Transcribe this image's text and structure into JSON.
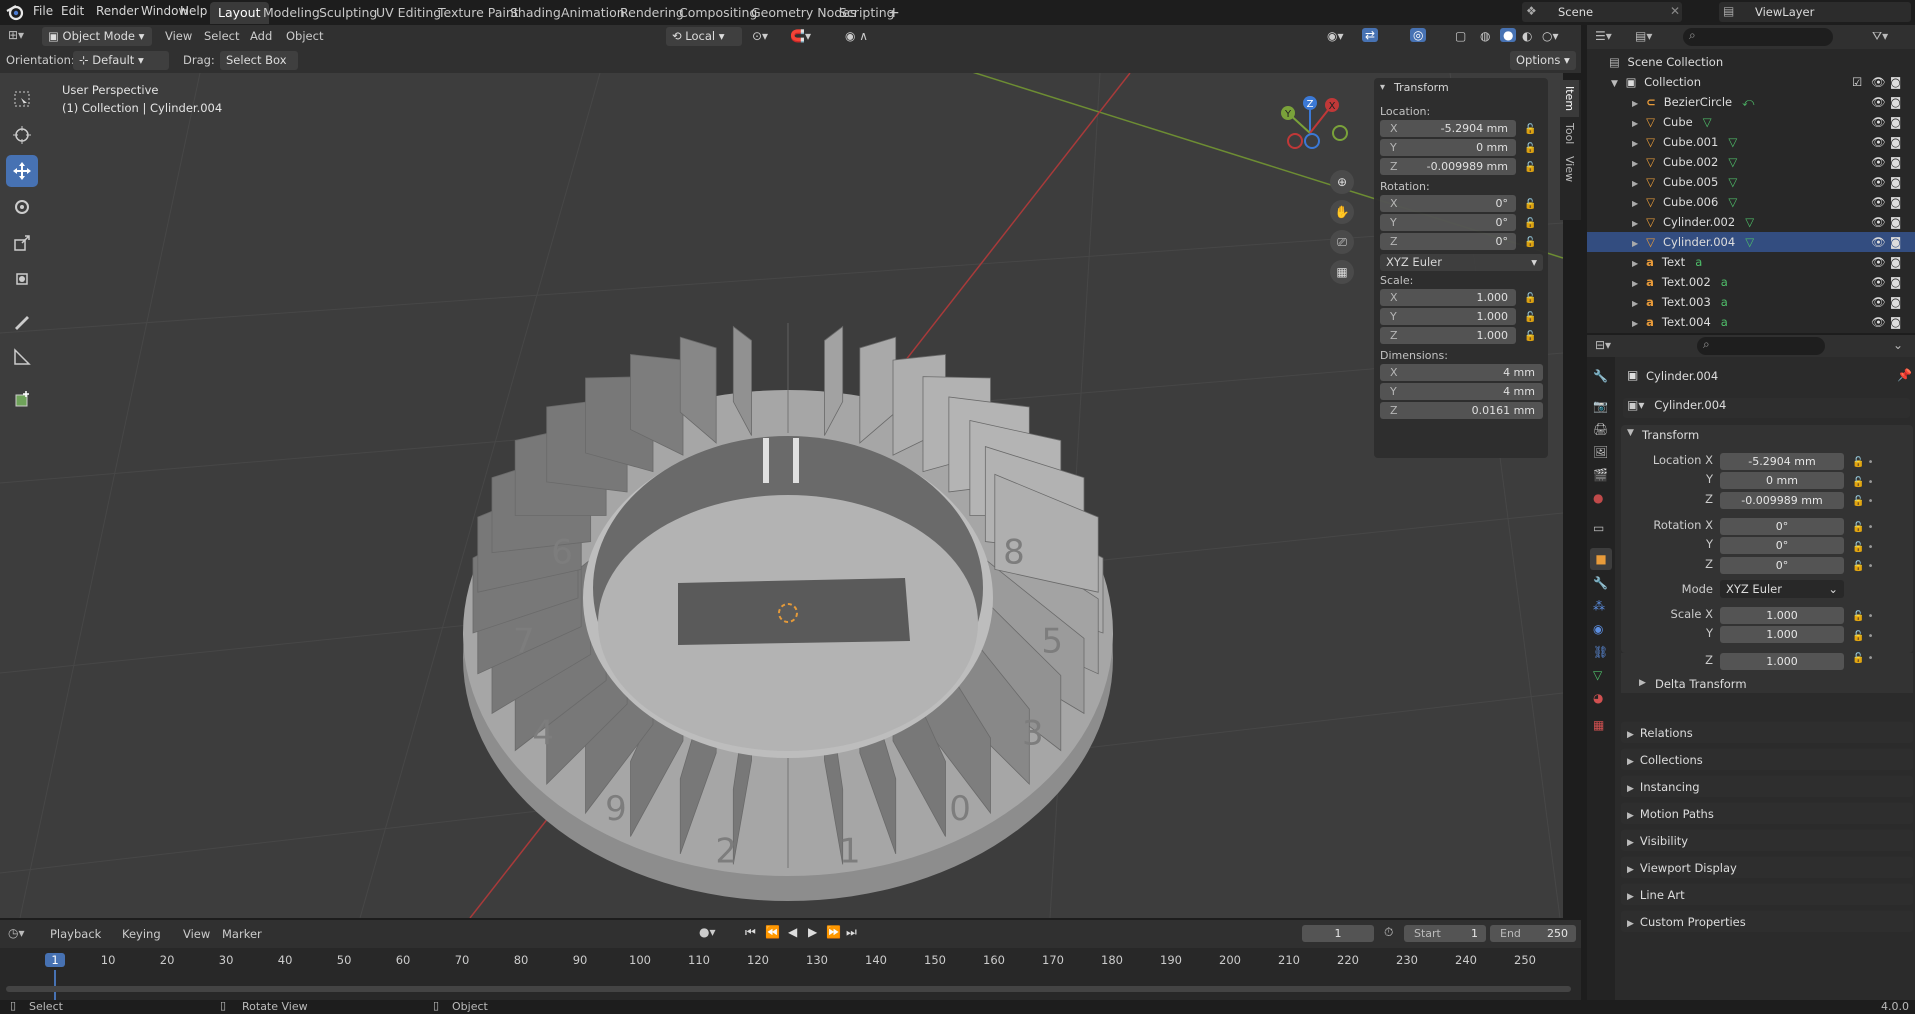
{
  "menus": [
    "File",
    "Edit",
    "Render",
    "Window",
    "Help"
  ],
  "workspaces": [
    "Layout",
    "Modeling",
    "Sculpting",
    "UV Editing",
    "Texture Paint",
    "Shading",
    "Animation",
    "Rendering",
    "Compositing",
    "Geometry Nodes",
    "Scripting"
  ],
  "active_workspace": "Layout",
  "scene": "Scene",
  "view_layer": "ViewLayer",
  "viewport_header": {
    "mode": "Object Mode",
    "menus": [
      "View",
      "Select",
      "Add",
      "Object"
    ],
    "pivot": "Local",
    "options": "Options"
  },
  "tool_settings": {
    "orientation_label": "Orientation:",
    "orientation": "Default",
    "drag_label": "Drag:",
    "drag": "Select Box"
  },
  "overlay": {
    "perspective": "User Perspective",
    "collection": "(1) Collection | Cylinder.004"
  },
  "npanel": {
    "title": "Transform",
    "location_label": "Location:",
    "rotation_label": "Rotation:",
    "scale_label": "Scale:",
    "dimensions_label": "Dimensions:",
    "axes": [
      "X",
      "Y",
      "Z"
    ],
    "location": [
      "-5.2904 mm",
      "0 mm",
      "-0.009989 mm"
    ],
    "rotation": [
      "0°",
      "0°",
      "0°"
    ],
    "rot_mode": "XYZ Euler",
    "scale": [
      "1.000",
      "1.000",
      "1.000"
    ],
    "dimensions": [
      "4 mm",
      "4 mm",
      "0.0161 mm"
    ],
    "tabs": [
      "Item",
      "Tool",
      "View"
    ]
  },
  "outliner": {
    "root": "Scene Collection",
    "collection": "Collection",
    "items": [
      {
        "name": "BezierCircle",
        "type": "curve"
      },
      {
        "name": "Cube",
        "type": "mesh"
      },
      {
        "name": "Cube.001",
        "type": "mesh"
      },
      {
        "name": "Cube.002",
        "type": "mesh"
      },
      {
        "name": "Cube.005",
        "type": "mesh"
      },
      {
        "name": "Cube.006",
        "type": "mesh"
      },
      {
        "name": "Cylinder.002",
        "type": "mesh"
      },
      {
        "name": "Cylinder.004",
        "type": "mesh"
      },
      {
        "name": "Text",
        "type": "text"
      },
      {
        "name": "Text.002",
        "type": "text"
      },
      {
        "name": "Text.003",
        "type": "text"
      },
      {
        "name": "Text.004",
        "type": "text"
      }
    ]
  },
  "properties": {
    "object_name": "Cylinder.004",
    "data_name": "Cylinder.004",
    "transform": "Transform",
    "loc_label": "Location X",
    "rot_label": "Rotation X",
    "scale_label": "Scale X",
    "y": "Y",
    "z": "Z",
    "mode_label": "Mode",
    "location": [
      "-5.2904 mm",
      "0 mm",
      "-0.009989 mm"
    ],
    "rotation": [
      "0°",
      "0°",
      "0°"
    ],
    "mode": "XYZ Euler",
    "scale": [
      "1.000",
      "1.000",
      "1.000"
    ],
    "delta": "Delta Transform",
    "sections": [
      "Relations",
      "Collections",
      "Instancing",
      "Motion Paths",
      "Visibility",
      "Viewport Display",
      "Line Art",
      "Custom Properties"
    ]
  },
  "timeline": {
    "menus": [
      "Playback",
      "Keying",
      "View",
      "Marker"
    ],
    "current_frame": "1",
    "start_label": "Start",
    "start": "1",
    "end_label": "End",
    "end": "250",
    "ticks": [
      "1",
      "10",
      "20",
      "30",
      "40",
      "50",
      "60",
      "70",
      "80",
      "90",
      "100",
      "110",
      "120",
      "130",
      "140",
      "150",
      "160",
      "170",
      "180",
      "190",
      "200",
      "210",
      "220",
      "230",
      "240",
      "250"
    ]
  },
  "status": {
    "select": "Select",
    "rotate": "Rotate View",
    "object": "Object",
    "version": "4.0.0"
  },
  "model_digits": [
    "8",
    "5",
    "3",
    "0",
    "1",
    "2",
    "9",
    "4",
    "7",
    "6"
  ],
  "colors": {
    "accent": "#4772b3",
    "viewport_bg": "#3d3d3d",
    "x_axis": "#c03838",
    "y_axis": "#7aa23a",
    "z_axis": "#3b79d6"
  }
}
